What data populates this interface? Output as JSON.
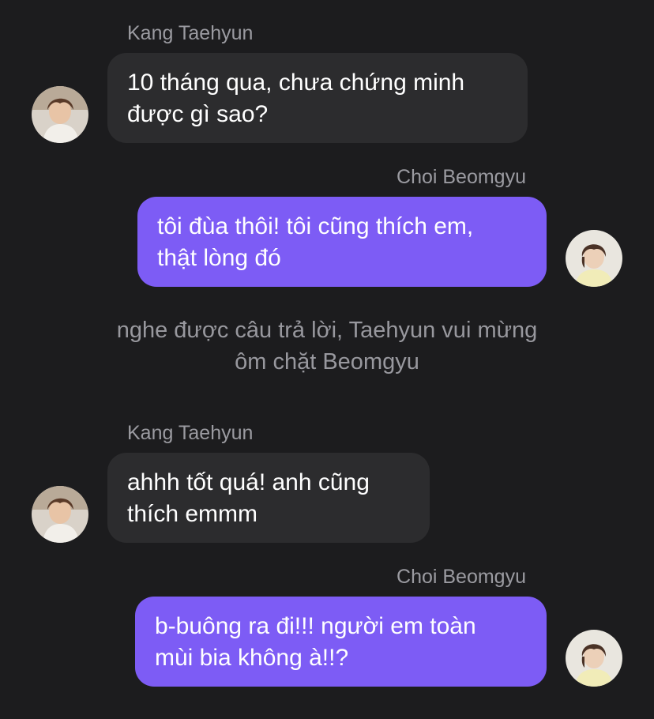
{
  "messages": [
    {
      "sender": "Kang Taehyun",
      "lines": [
        "10 tháng qua, chưa chứng minh",
        "được gì sao?"
      ]
    },
    {
      "sender": "Choi Beomgyu",
      "lines": [
        "tôi đùa thôi! tôi cũng thích em,",
        "thật lòng đó"
      ]
    },
    {
      "sender": "Kang Taehyun",
      "lines": [
        "ahhh tốt quá! anh cũng",
        "thích emmm"
      ]
    },
    {
      "sender": "Choi Beomgyu",
      "lines": [
        "b-buông ra đi!!! người em toàn",
        "mùi bia không à!!?"
      ]
    }
  ],
  "narration": {
    "lines": [
      "nghe được câu trả lời, Taehyun vui mừng",
      "ôm chặt Beomgyu"
    ]
  },
  "colors": {
    "background": "#1c1c1e",
    "incoming_bubble": "#2c2c2e",
    "outgoing_bubble": "#7d5cf5",
    "sender_name": "#9b9ba1",
    "narration_text": "#98989e"
  },
  "icons": {
    "taehyun_avatar": "taehyun-avatar-icon",
    "beomgyu_avatar": "beomgyu-avatar-icon"
  }
}
